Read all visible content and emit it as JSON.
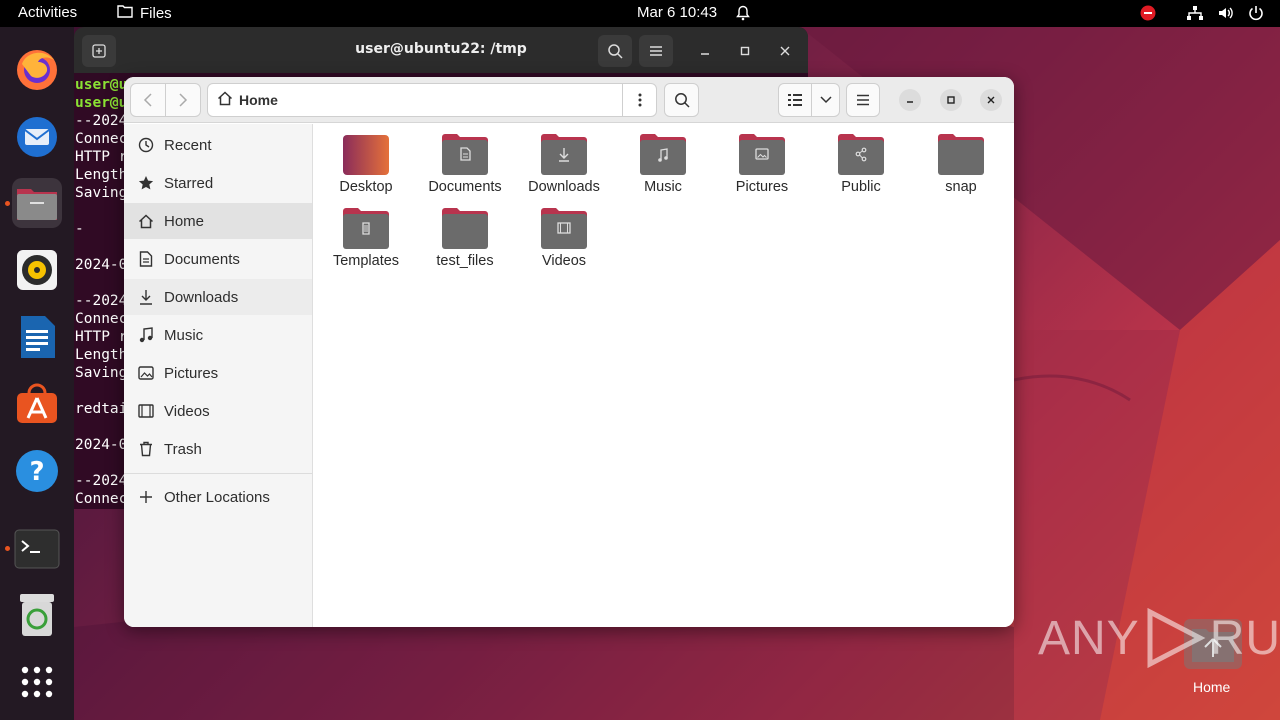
{
  "topbar": {
    "activities": "Activities",
    "app_name": "Files",
    "clock": "Mar 6  10:43"
  },
  "dock": {
    "items": [
      "firefox-icon",
      "thunderbird-icon",
      "files-icon",
      "rhythmbox-icon",
      "libreoffice-writer-icon",
      "app-center-icon",
      "help-icon",
      "terminal-icon",
      "trash-icon",
      "show-apps-icon"
    ]
  },
  "terminal": {
    "title": "user@ubuntu22: /tmp",
    "lines": [
      {
        "host": "user@u",
        "text": ""
      },
      {
        "host": "user@u",
        "text": ""
      },
      {
        "host": "",
        "text": "--2024"
      },
      {
        "host": "",
        "text": "Connec"
      },
      {
        "host": "",
        "text": "HTTP r"
      },
      {
        "host": "",
        "text": "Length"
      },
      {
        "host": "",
        "text": "Saving"
      },
      {
        "host": "",
        "text": ""
      },
      {
        "host": "",
        "text": "-"
      },
      {
        "host": "",
        "text": ""
      },
      {
        "host": "",
        "text": "2024-0"
      },
      {
        "host": "",
        "text": ""
      },
      {
        "host": "",
        "text": "--2024"
      },
      {
        "host": "",
        "text": "Connec"
      },
      {
        "host": "",
        "text": "HTTP r"
      },
      {
        "host": "",
        "text": "Length"
      },
      {
        "host": "",
        "text": "Saving"
      },
      {
        "host": "",
        "text": ""
      },
      {
        "host": "",
        "text": "redtai"
      },
      {
        "host": "",
        "text": ""
      },
      {
        "host": "",
        "text": "2024-0"
      },
      {
        "host": "",
        "text": ""
      },
      {
        "host": "",
        "text": "--2024"
      },
      {
        "host": "",
        "text": "Connec"
      }
    ]
  },
  "files": {
    "location": "Home",
    "sidebar": {
      "items": [
        {
          "label": "Recent",
          "icon": "clock-icon"
        },
        {
          "label": "Starred",
          "icon": "star-icon"
        },
        {
          "label": "Home",
          "icon": "home-icon"
        },
        {
          "label": "Documents",
          "icon": "document-icon"
        },
        {
          "label": "Downloads",
          "icon": "download-icon"
        },
        {
          "label": "Music",
          "icon": "music-icon"
        },
        {
          "label": "Pictures",
          "icon": "picture-icon"
        },
        {
          "label": "Videos",
          "icon": "video-icon"
        },
        {
          "label": "Trash",
          "icon": "trash-icon"
        }
      ],
      "other_locations": "Other Locations"
    },
    "folders": [
      {
        "label": "Desktop",
        "emblem": "none"
      },
      {
        "label": "Documents",
        "emblem": "document"
      },
      {
        "label": "Downloads",
        "emblem": "download"
      },
      {
        "label": "Music",
        "emblem": "music"
      },
      {
        "label": "Pictures",
        "emblem": "picture"
      },
      {
        "label": "Public",
        "emblem": "share"
      },
      {
        "label": "snap",
        "emblem": "none"
      },
      {
        "label": "Templates",
        "emblem": "template"
      },
      {
        "label": "test_files",
        "emblem": "none"
      },
      {
        "label": "Videos",
        "emblem": "video"
      }
    ]
  },
  "desktop": {
    "home_label": "Home",
    "watermark": "ANY RUN"
  },
  "colors": {
    "accent": "#e95420",
    "terminal_bg": "#300a24",
    "folder_body": "#6b6b6b",
    "folder_tab": "#b8344e"
  }
}
